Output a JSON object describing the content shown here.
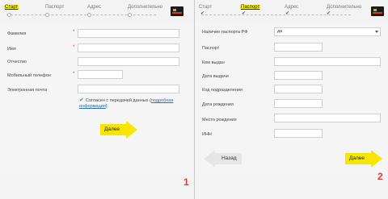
{
  "panel1": {
    "steps": [
      "Старт",
      "Паспорт",
      "Адрес",
      "Дополнительно"
    ],
    "fields": [
      {
        "label": "Фамилия",
        "required": true
      },
      {
        "label": "Имя",
        "required": true
      },
      {
        "label": "Отчество",
        "required": false
      },
      {
        "label": "Мобильный телефон",
        "required": true
      },
      {
        "label": "Электронная почта",
        "required": false
      }
    ],
    "consent_text": "Согласен с передачей данных (",
    "consent_link": "подробная информация",
    "consent_end": ")",
    "next_label": "Далее",
    "number": "1"
  },
  "panel2": {
    "steps": [
      "Старт",
      "Паспорт",
      "Адрес",
      "Дополнительно"
    ],
    "fields": [
      {
        "label": "Наличие паспорта РФ",
        "value": "да"
      },
      {
        "label": "Паспорт"
      },
      {
        "label": "Кем выдан"
      },
      {
        "label": "Дата выдачи"
      },
      {
        "label": "Код подразделения"
      },
      {
        "label": "Дата рождения"
      },
      {
        "label": "Место рождения"
      },
      {
        "label": "ИНН"
      }
    ],
    "back_label": "Назад",
    "next_label": "Далее",
    "number": "2"
  },
  "colors": {
    "accent": "#f7e600",
    "required": "#e03030",
    "number": "#e53935",
    "link": "#2a6fb5"
  }
}
